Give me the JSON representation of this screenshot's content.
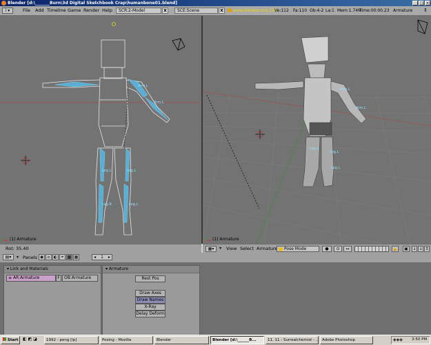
{
  "window": {
    "title": "Blender [d:\\_______Burn\\3d Digital Sketchbook Crap\\humanbone01.blend]"
  },
  "menu": {
    "items": [
      "File",
      "Add",
      "Timeline",
      "Game",
      "Render",
      "Help"
    ]
  },
  "screen": {
    "name": "SCR:2-Model"
  },
  "scene": {
    "name": "SCE:Scene"
  },
  "stats": {
    "url": "www.blender.org 234",
    "ve": "Ve:112",
    "fa": "Fa:110",
    "ob": "Ob:4-2",
    "la": "La:1",
    "mem": "Mem:1.74M",
    "time": "Time:00:00.23",
    "object": "Armature"
  },
  "viewport_left": {
    "label": "(1) Armature",
    "bones": [
      "Arm.L",
      "Arm.L",
      "Leg.L",
      "Leg.L",
      "Leg.R",
      "Leg.L"
    ]
  },
  "viewport_right": {
    "label": "(1) Armature",
    "bones": [
      "Arm.L",
      "Arm.L",
      "Leg.L",
      "Leg.L",
      "Leg.L"
    ]
  },
  "status": {
    "rot": "Rot: 35.40"
  },
  "view3d_header": {
    "view": "View",
    "select": "Select",
    "armature": "Armature",
    "mode": "Pose Mode"
  },
  "buttons_header": {
    "panels": "Panels",
    "frame": "1"
  },
  "link_panel": {
    "title": "Link and Materials",
    "ar": "AR:Armature",
    "f": "F",
    "ob": "OB:Armature"
  },
  "armature_panel": {
    "title": "Armature",
    "rest_pos": "Rest Pos",
    "draw_axes": "Draw Axes",
    "draw_names": "Draw Names",
    "xray": "X-Ray",
    "delay_deform": "Delay Deform"
  },
  "taskbar": {
    "start": "Start",
    "tasks": [
      "1992 - peng [lp]",
      "Posing - Mozilla",
      "Blender",
      "Blender [d:\\______B...",
      "11. 11 - Surrealchemist - ...",
      "Adobe Photoshop"
    ],
    "clock": "3:50 PM"
  }
}
